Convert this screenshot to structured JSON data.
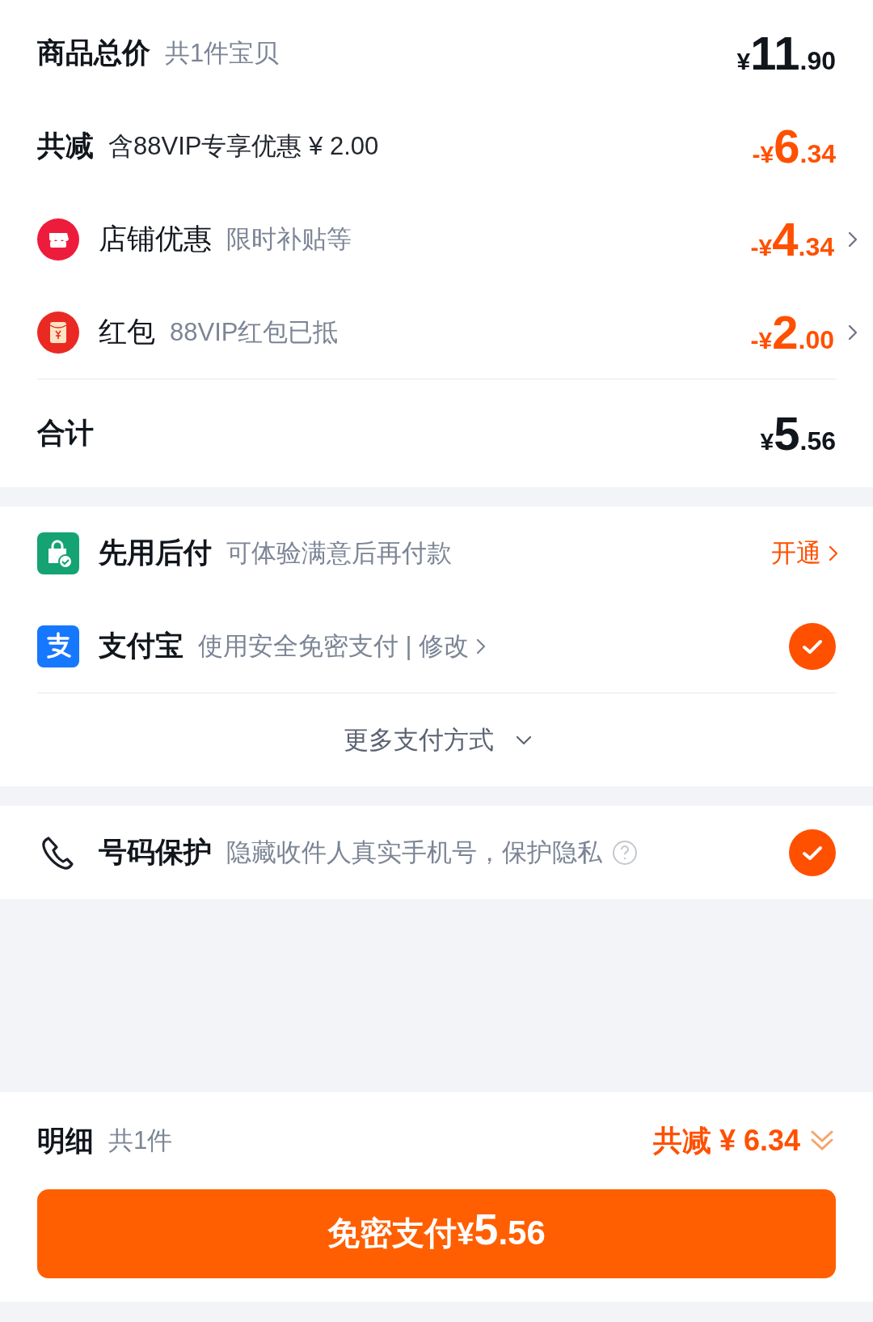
{
  "summary": {
    "title": "商品总价",
    "subtitle": "共1件宝贝",
    "price": {
      "currency": "¥",
      "integer": "11",
      "decimal": ".90"
    }
  },
  "discount": {
    "title": "共减",
    "subtitle": "含88VIP专享优惠 ¥ 2.00",
    "price": {
      "currency": "-¥",
      "integer": "6",
      "decimal": ".34"
    }
  },
  "discount_items": [
    {
      "title": "店铺优惠",
      "subtitle": "限时补贴等",
      "price": {
        "currency": "-¥",
        "integer": "4",
        "decimal": ".34"
      }
    },
    {
      "title": "红包",
      "subtitle": "88VIP红包已抵",
      "price": {
        "currency": "-¥",
        "integer": "2",
        "decimal": ".00"
      }
    }
  ],
  "total": {
    "title": "合计",
    "price": {
      "currency": "¥",
      "integer": "5",
      "decimal": ".56"
    }
  },
  "payment_methods": [
    {
      "kind": "pay_later",
      "title": "先用后付",
      "subtitle": "可体验满意后再付款",
      "action": "开通",
      "selected": false
    },
    {
      "kind": "alipay",
      "title": "支付宝",
      "subtitle": "使用安全免密支付 | 修改",
      "selected": true
    }
  ],
  "more_payment": "更多支付方式",
  "number_protection": {
    "title": "号码保护",
    "subtitle": "隐藏收件人真实手机号，保护隐私",
    "checked": true
  },
  "footer": {
    "title": "明细",
    "subtitle": "共1件",
    "discount": "共减 ¥ 6.34"
  },
  "pay_button": {
    "label": "免密支付",
    "price": {
      "currency": "¥",
      "integer": "5",
      "decimal": ".56"
    }
  }
}
